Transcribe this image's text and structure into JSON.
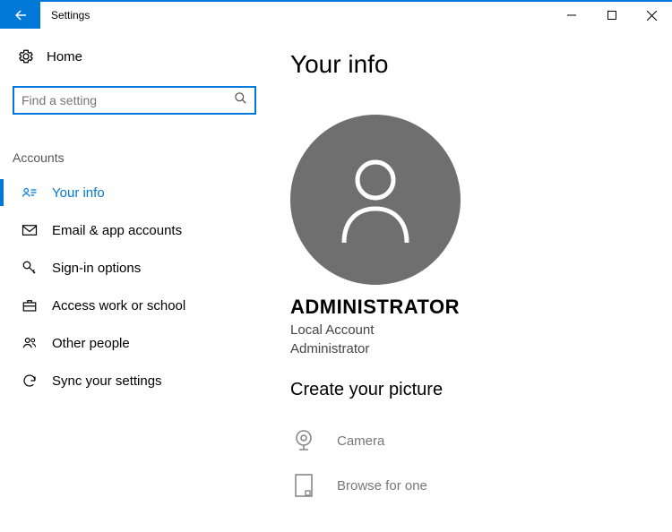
{
  "window": {
    "title": "Settings"
  },
  "sidebar": {
    "home_label": "Home",
    "search_placeholder": "Find a setting",
    "section_label": "Accounts",
    "items": [
      {
        "label": "Your info"
      },
      {
        "label": "Email & app accounts"
      },
      {
        "label": "Sign-in options"
      },
      {
        "label": "Access work or school"
      },
      {
        "label": "Other people"
      },
      {
        "label": "Sync your settings"
      }
    ]
  },
  "main": {
    "heading": "Your info",
    "user_name": "ADMINISTRATOR",
    "account_type": "Local Account",
    "role": "Administrator",
    "picture_section": "Create your picture",
    "options": [
      {
        "label": "Camera"
      },
      {
        "label": "Browse for one"
      }
    ]
  }
}
